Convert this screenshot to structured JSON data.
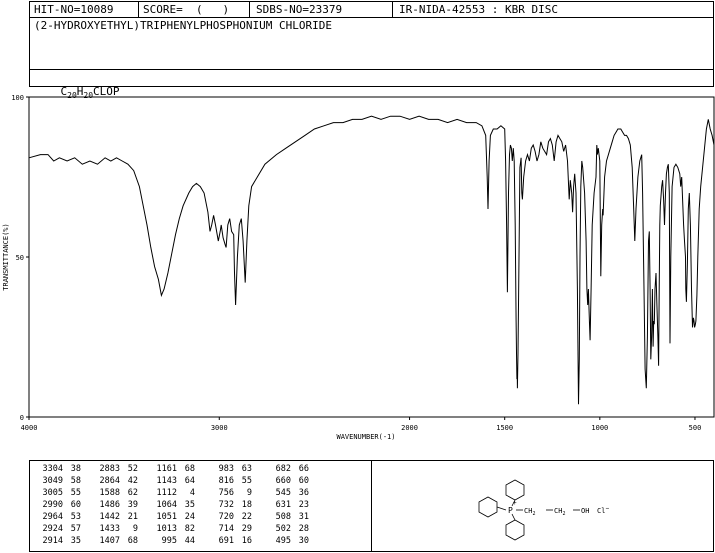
{
  "header": {
    "hit_no": "HIT-NO=10089",
    "score": "SCORE=  (   )",
    "sdbs_no": "SDBS-NO=23379",
    "ir_info": "IR-NIDA-42553 : KBR DISC",
    "compound_name": "(2-HYDROXYETHYL)TRIPHENYLPHOSPHONIUM CHLORIDE",
    "formula": {
      "c": "C",
      "c_n": "20",
      "h": "H",
      "h_n": "20",
      "rest": "CLOP"
    }
  },
  "chart_data": {
    "type": "line",
    "xlabel": "WAVENUMBER(-1)",
    "ylabel": "TRANSMITTANCE(%)",
    "xlim": [
      4000,
      400
    ],
    "ylim": [
      0,
      100
    ],
    "x_ticks": [
      4000,
      3000,
      2000,
      1500,
      1000,
      500
    ],
    "y_ticks": [
      0,
      50,
      100
    ],
    "x_tick_labels": [
      "4000",
      "3000",
      "2000",
      "1500",
      "1000",
      "500"
    ],
    "y_tick_labels": [
      "0",
      "50",
      "100"
    ],
    "grid": false,
    "spectrum": [
      [
        4000,
        81
      ],
      [
        3940,
        82
      ],
      [
        3900,
        82
      ],
      [
        3870,
        80
      ],
      [
        3840,
        81
      ],
      [
        3800,
        80
      ],
      [
        3760,
        81
      ],
      [
        3720,
        79
      ],
      [
        3680,
        80
      ],
      [
        3640,
        79
      ],
      [
        3600,
        81
      ],
      [
        3570,
        80
      ],
      [
        3540,
        81
      ],
      [
        3510,
        80
      ],
      [
        3480,
        79
      ],
      [
        3450,
        77
      ],
      [
        3420,
        72
      ],
      [
        3400,
        66
      ],
      [
        3380,
        60
      ],
      [
        3360,
        53
      ],
      [
        3340,
        47
      ],
      [
        3320,
        43
      ],
      [
        3304,
        38
      ],
      [
        3290,
        40
      ],
      [
        3270,
        45
      ],
      [
        3250,
        51
      ],
      [
        3230,
        57
      ],
      [
        3210,
        62
      ],
      [
        3190,
        66
      ],
      [
        3160,
        70
      ],
      [
        3140,
        72
      ],
      [
        3120,
        73
      ],
      [
        3100,
        72
      ],
      [
        3080,
        70
      ],
      [
        3060,
        64
      ],
      [
        3049,
        58
      ],
      [
        3040,
        60
      ],
      [
        3030,
        63
      ],
      [
        3020,
        60
      ],
      [
        3005,
        55
      ],
      [
        2995,
        58
      ],
      [
        2990,
        60
      ],
      [
        2980,
        56
      ],
      [
        2970,
        54
      ],
      [
        2964,
        53
      ],
      [
        2955,
        60
      ],
      [
        2945,
        62
      ],
      [
        2935,
        58
      ],
      [
        2924,
        57
      ],
      [
        2920,
        45
      ],
      [
        2914,
        35
      ],
      [
        2905,
        50
      ],
      [
        2895,
        60
      ],
      [
        2884,
        62
      ],
      [
        2875,
        55
      ],
      [
        2864,
        42
      ],
      [
        2855,
        55
      ],
      [
        2845,
        66
      ],
      [
        2830,
        72
      ],
      [
        2800,
        75
      ],
      [
        2760,
        79
      ],
      [
        2700,
        82
      ],
      [
        2650,
        84
      ],
      [
        2600,
        86
      ],
      [
        2550,
        88
      ],
      [
        2500,
        90
      ],
      [
        2450,
        91
      ],
      [
        2400,
        92
      ],
      [
        2350,
        92
      ],
      [
        2300,
        93
      ],
      [
        2250,
        93
      ],
      [
        2200,
        94
      ],
      [
        2150,
        93
      ],
      [
        2100,
        94
      ],
      [
        2050,
        94
      ],
      [
        2000,
        93
      ],
      [
        1950,
        94
      ],
      [
        1900,
        93
      ],
      [
        1850,
        93
      ],
      [
        1800,
        92
      ],
      [
        1750,
        93
      ],
      [
        1700,
        92
      ],
      [
        1650,
        92
      ],
      [
        1620,
        91
      ],
      [
        1600,
        88
      ],
      [
        1592,
        75
      ],
      [
        1588,
        65
      ],
      [
        1582,
        80
      ],
      [
        1575,
        88
      ],
      [
        1560,
        90
      ],
      [
        1540,
        90
      ],
      [
        1520,
        91
      ],
      [
        1500,
        90
      ],
      [
        1495,
        80
      ],
      [
        1490,
        60
      ],
      [
        1486,
        39
      ],
      [
        1480,
        70
      ],
      [
        1475,
        82
      ],
      [
        1470,
        85
      ],
      [
        1465,
        84
      ],
      [
        1460,
        80
      ],
      [
        1455,
        84
      ],
      [
        1450,
        80
      ],
      [
        1445,
        60
      ],
      [
        1440,
        30
      ],
      [
        1438,
        20
      ],
      [
        1436,
        12
      ],
      [
        1434,
        12
      ],
      [
        1433,
        9
      ],
      [
        1430,
        20
      ],
      [
        1425,
        50
      ],
      [
        1420,
        78
      ],
      [
        1414,
        81
      ],
      [
        1410,
        70
      ],
      [
        1407,
        68
      ],
      [
        1400,
        75
      ],
      [
        1390,
        80
      ],
      [
        1380,
        82
      ],
      [
        1370,
        80
      ],
      [
        1360,
        84
      ],
      [
        1350,
        85
      ],
      [
        1340,
        83
      ],
      [
        1330,
        80
      ],
      [
        1320,
        82
      ],
      [
        1310,
        86
      ],
      [
        1300,
        84
      ],
      [
        1280,
        82
      ],
      [
        1270,
        86
      ],
      [
        1260,
        87
      ],
      [
        1250,
        85
      ],
      [
        1240,
        80
      ],
      [
        1230,
        86
      ],
      [
        1220,
        88
      ],
      [
        1210,
        87
      ],
      [
        1200,
        86
      ],
      [
        1190,
        83
      ],
      [
        1180,
        85
      ],
      [
        1170,
        80
      ],
      [
        1161,
        68
      ],
      [
        1155,
        74
      ],
      [
        1148,
        70
      ],
      [
        1143,
        64
      ],
      [
        1138,
        72
      ],
      [
        1132,
        76
      ],
      [
        1125,
        70
      ],
      [
        1118,
        40
      ],
      [
        1115,
        20
      ],
      [
        1112,
        4
      ],
      [
        1108,
        18
      ],
      [
        1104,
        50
      ],
      [
        1100,
        72
      ],
      [
        1095,
        80
      ],
      [
        1090,
        78
      ],
      [
        1080,
        70
      ],
      [
        1072,
        55
      ],
      [
        1068,
        40
      ],
      [
        1064,
        35
      ],
      [
        1060,
        40
      ],
      [
        1055,
        30
      ],
      [
        1051,
        24
      ],
      [
        1046,
        40
      ],
      [
        1040,
        60
      ],
      [
        1030,
        70
      ],
      [
        1020,
        75
      ],
      [
        1016,
        85
      ],
      [
        1013,
        82
      ],
      [
        1008,
        84
      ],
      [
        1000,
        80
      ],
      [
        995,
        44
      ],
      [
        990,
        60
      ],
      [
        985,
        65
      ],
      [
        983,
        63
      ],
      [
        975,
        75
      ],
      [
        965,
        80
      ],
      [
        955,
        82
      ],
      [
        945,
        84
      ],
      [
        935,
        86
      ],
      [
        925,
        88
      ],
      [
        915,
        89
      ],
      [
        905,
        90
      ],
      [
        890,
        90
      ],
      [
        880,
        89
      ],
      [
        870,
        88
      ],
      [
        860,
        88
      ],
      [
        850,
        87
      ],
      [
        840,
        85
      ],
      [
        830,
        78
      ],
      [
        822,
        65
      ],
      [
        816,
        55
      ],
      [
        810,
        65
      ],
      [
        800,
        75
      ],
      [
        790,
        80
      ],
      [
        780,
        82
      ],
      [
        775,
        70
      ],
      [
        768,
        40
      ],
      [
        762,
        15
      ],
      [
        756,
        9
      ],
      [
        750,
        25
      ],
      [
        744,
        55
      ],
      [
        740,
        58
      ],
      [
        736,
        40
      ],
      [
        732,
        18
      ],
      [
        728,
        25
      ],
      [
        724,
        40
      ],
      [
        720,
        22
      ],
      [
        717,
        30
      ],
      [
        714,
        29
      ],
      [
        710,
        40
      ],
      [
        705,
        45
      ],
      [
        700,
        35
      ],
      [
        695,
        25
      ],
      [
        691,
        16
      ],
      [
        688,
        40
      ],
      [
        685,
        60
      ],
      [
        682,
        66
      ],
      [
        675,
        72
      ],
      [
        670,
        74
      ],
      [
        665,
        68
      ],
      [
        660,
        60
      ],
      [
        655,
        70
      ],
      [
        650,
        76
      ],
      [
        645,
        78
      ],
      [
        640,
        79
      ],
      [
        635,
        70
      ],
      [
        631,
        23
      ],
      [
        627,
        50
      ],
      [
        620,
        72
      ],
      [
        610,
        78
      ],
      [
        600,
        79
      ],
      [
        590,
        78
      ],
      [
        580,
        76
      ],
      [
        575,
        72
      ],
      [
        570,
        75
      ],
      [
        560,
        60
      ],
      [
        555,
        55
      ],
      [
        550,
        50
      ],
      [
        548,
        40
      ],
      [
        545,
        36
      ],
      [
        540,
        48
      ],
      [
        535,
        65
      ],
      [
        530,
        70
      ],
      [
        524,
        60
      ],
      [
        518,
        40
      ],
      [
        513,
        28
      ],
      [
        510,
        30
      ],
      [
        508,
        31
      ],
      [
        505,
        30
      ],
      [
        502,
        28
      ],
      [
        498,
        29
      ],
      [
        495,
        30
      ],
      [
        490,
        38
      ],
      [
        485,
        50
      ],
      [
        478,
        65
      ],
      [
        470,
        72
      ],
      [
        460,
        78
      ],
      [
        450,
        84
      ],
      [
        440,
        90
      ],
      [
        430,
        93
      ],
      [
        420,
        90
      ],
      [
        410,
        88
      ],
      [
        400,
        85
      ]
    ],
    "peak_table": [
      [
        [
          "3304",
          "38"
        ],
        [
          "3049",
          "58"
        ],
        [
          "3005",
          "55"
        ],
        [
          "2990",
          "60"
        ],
        [
          "2964",
          "53"
        ],
        [
          "2924",
          "57"
        ],
        [
          "2914",
          "35"
        ]
      ],
      [
        [
          "2883",
          "52"
        ],
        [
          "2864",
          "42"
        ],
        [
          "1588",
          "62"
        ],
        [
          "1486",
          "39"
        ],
        [
          "1442",
          "21"
        ],
        [
          "1433",
          "9"
        ],
        [
          "1407",
          "68"
        ]
      ],
      [
        [
          "1161",
          "68"
        ],
        [
          "1143",
          "64"
        ],
        [
          "1112",
          "4"
        ],
        [
          "1064",
          "35"
        ],
        [
          "1051",
          "24"
        ],
        [
          "1013",
          "82"
        ],
        [
          "995",
          "44"
        ]
      ],
      [
        [
          "983",
          "63"
        ],
        [
          "816",
          "55"
        ],
        [
          "756",
          "9"
        ],
        [
          "732",
          "18"
        ],
        [
          "720",
          "22"
        ],
        [
          "714",
          "29"
        ],
        [
          "691",
          "16"
        ]
      ],
      [
        [
          "682",
          "66"
        ],
        [
          "660",
          "60"
        ],
        [
          "545",
          "36"
        ],
        [
          "631",
          "23"
        ],
        [
          "508",
          "31"
        ],
        [
          "502",
          "28"
        ],
        [
          "495",
          "30"
        ]
      ]
    ]
  },
  "structure": {
    "group1": "CH",
    "group1_sub": "2",
    "group2": "CH",
    "group2_sub": "2",
    "oh": "OH",
    "p": "P",
    "plus": "+",
    "counter_ion": "Cl",
    "counter_charge": "−"
  }
}
